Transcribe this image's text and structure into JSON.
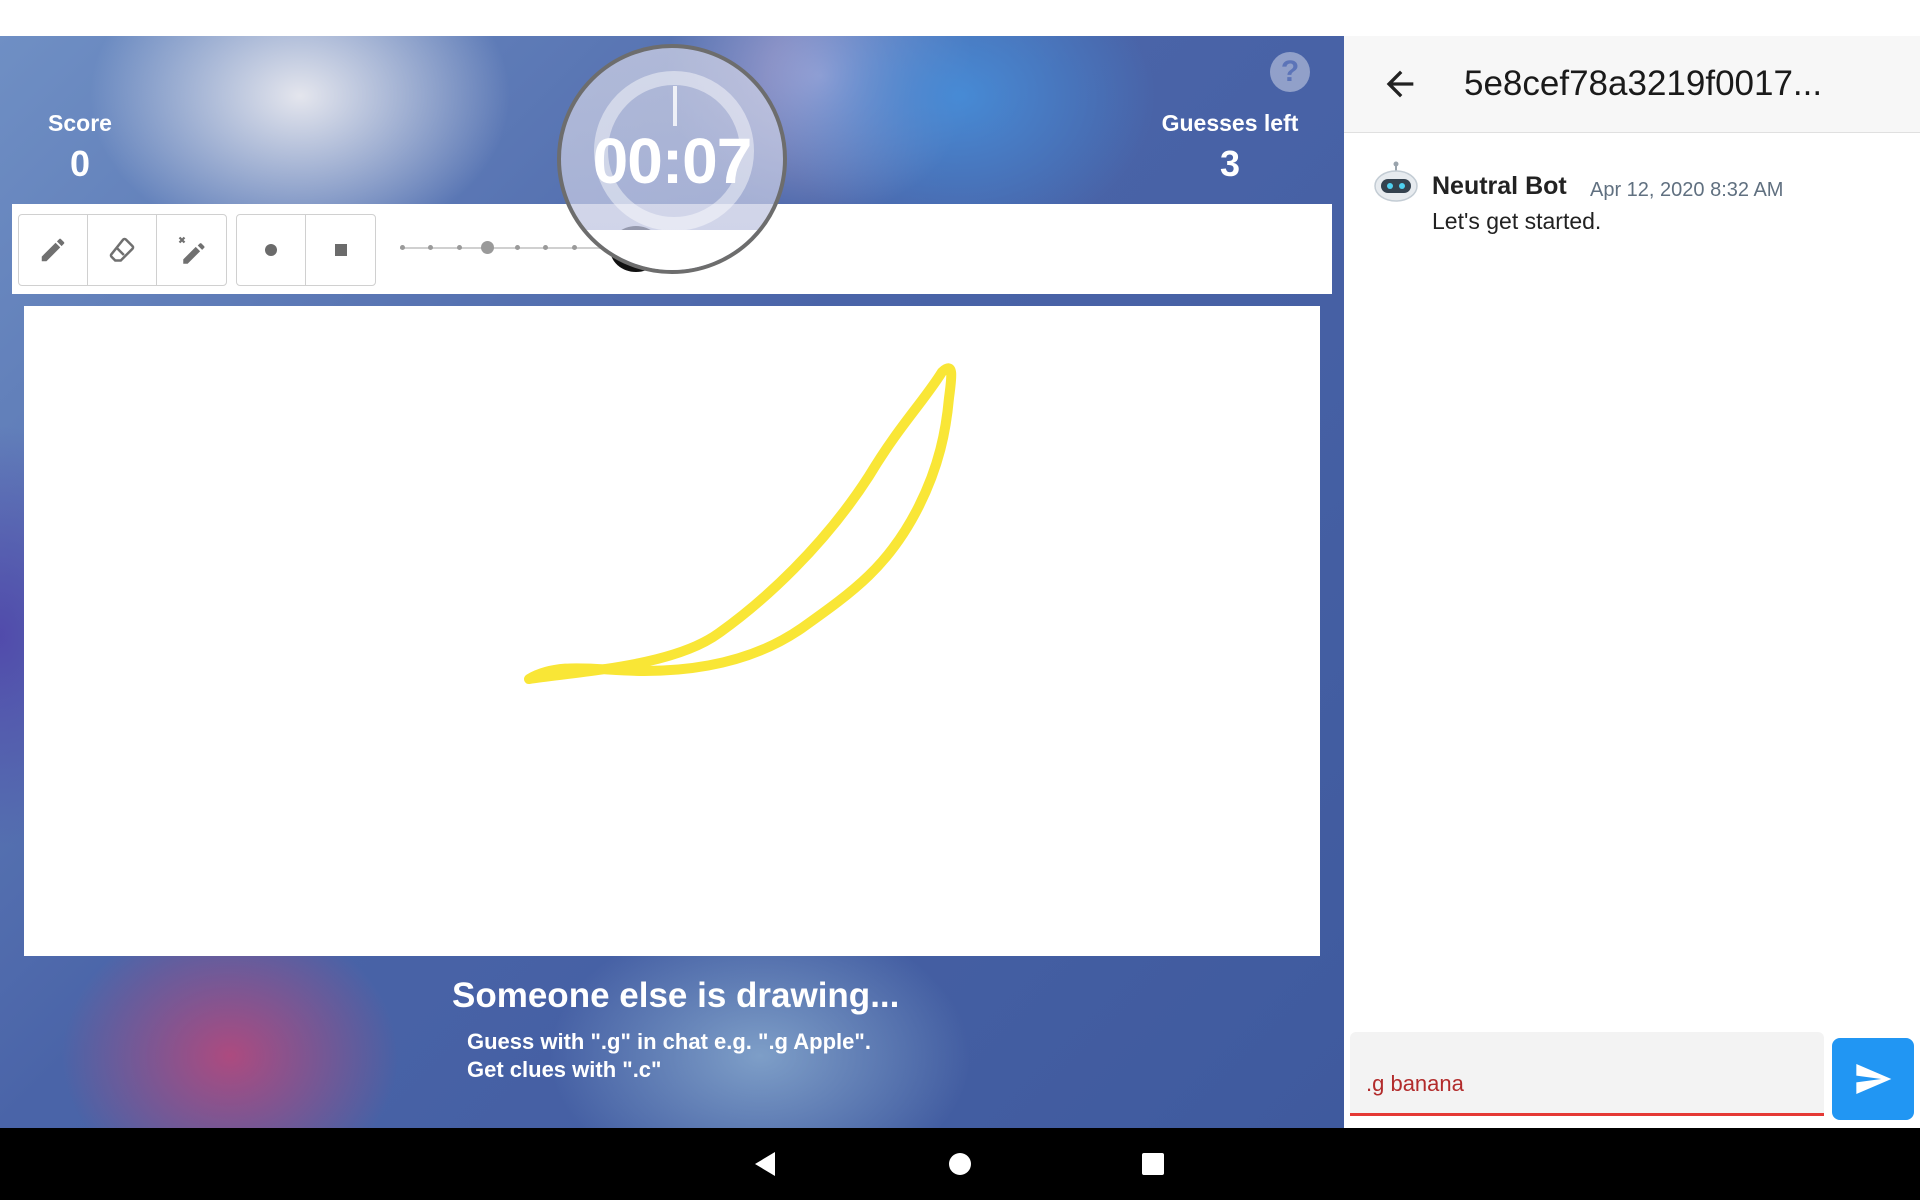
{
  "game": {
    "score_label": "Score",
    "score_value": "0",
    "guesses_label": "Guesses left",
    "guesses_value": "3",
    "help_icon": "?",
    "timer": "00:07",
    "drawing_message": "Someone else is drawing...",
    "hint_line1": "Guess with \".g\" in chat e.g. \".g Apple\".",
    "hint_line2": "Get clues with \".c\"",
    "drawing_color": "#f9e636",
    "toolbar": {
      "tools": [
        "pencil-icon",
        "eraser-icon",
        "magic-pencil-icon"
      ],
      "brush_shapes": [
        "circle-brush-icon",
        "square-brush-icon"
      ],
      "brush_size_steps": 7,
      "brush_size_selected_step": 4
    }
  },
  "chat": {
    "title": "5e8cef78a3219f0017...",
    "messages": [
      {
        "sender": "Neutral Bot",
        "time": "Apr 12, 2020 8:32 AM",
        "text": "Let's get started."
      }
    ],
    "input_value": ".g banana",
    "accent_color": "#2196f3",
    "error_color": "#e53935"
  },
  "navbar": {
    "icons": [
      "back-nav-icon",
      "home-nav-icon",
      "recents-nav-icon"
    ]
  }
}
